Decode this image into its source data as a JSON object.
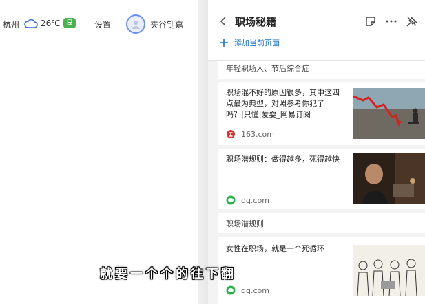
{
  "topbar": {
    "city": "杭州",
    "temperature": "26℃",
    "air_quality": "良",
    "settings_label": "设置",
    "username": "夹谷钊嘉"
  },
  "panel": {
    "title": "职场秘籍",
    "add_current_page_label": "添加当前页面",
    "icons": [
      "back-icon",
      "note-icon",
      "more-icon",
      "pin-icon"
    ],
    "items": [
      {
        "type": "text",
        "label": "年轻职场人、节后综合症"
      },
      {
        "type": "article",
        "title": "职场混不好的原因很多，其中这四点最为典型，对照参考你犯了吗？|只懂|爱耍_网易订阅",
        "source": "163.com"
      },
      {
        "type": "article",
        "title": "职场潜规则：做得越多，死得越快",
        "source": "qq.com"
      },
      {
        "type": "text",
        "label": "职场潜规则"
      },
      {
        "type": "article",
        "title": "女性在职场，就是一个死循环",
        "source": "qq.com"
      }
    ]
  },
  "subtitle": "就要一个个的往下翻",
  "colors": {
    "accent": "#1a6fc9",
    "aqi_badge": "#4caf50",
    "netease_red": "#d6332c",
    "wechat_green": "#2bb24c"
  }
}
